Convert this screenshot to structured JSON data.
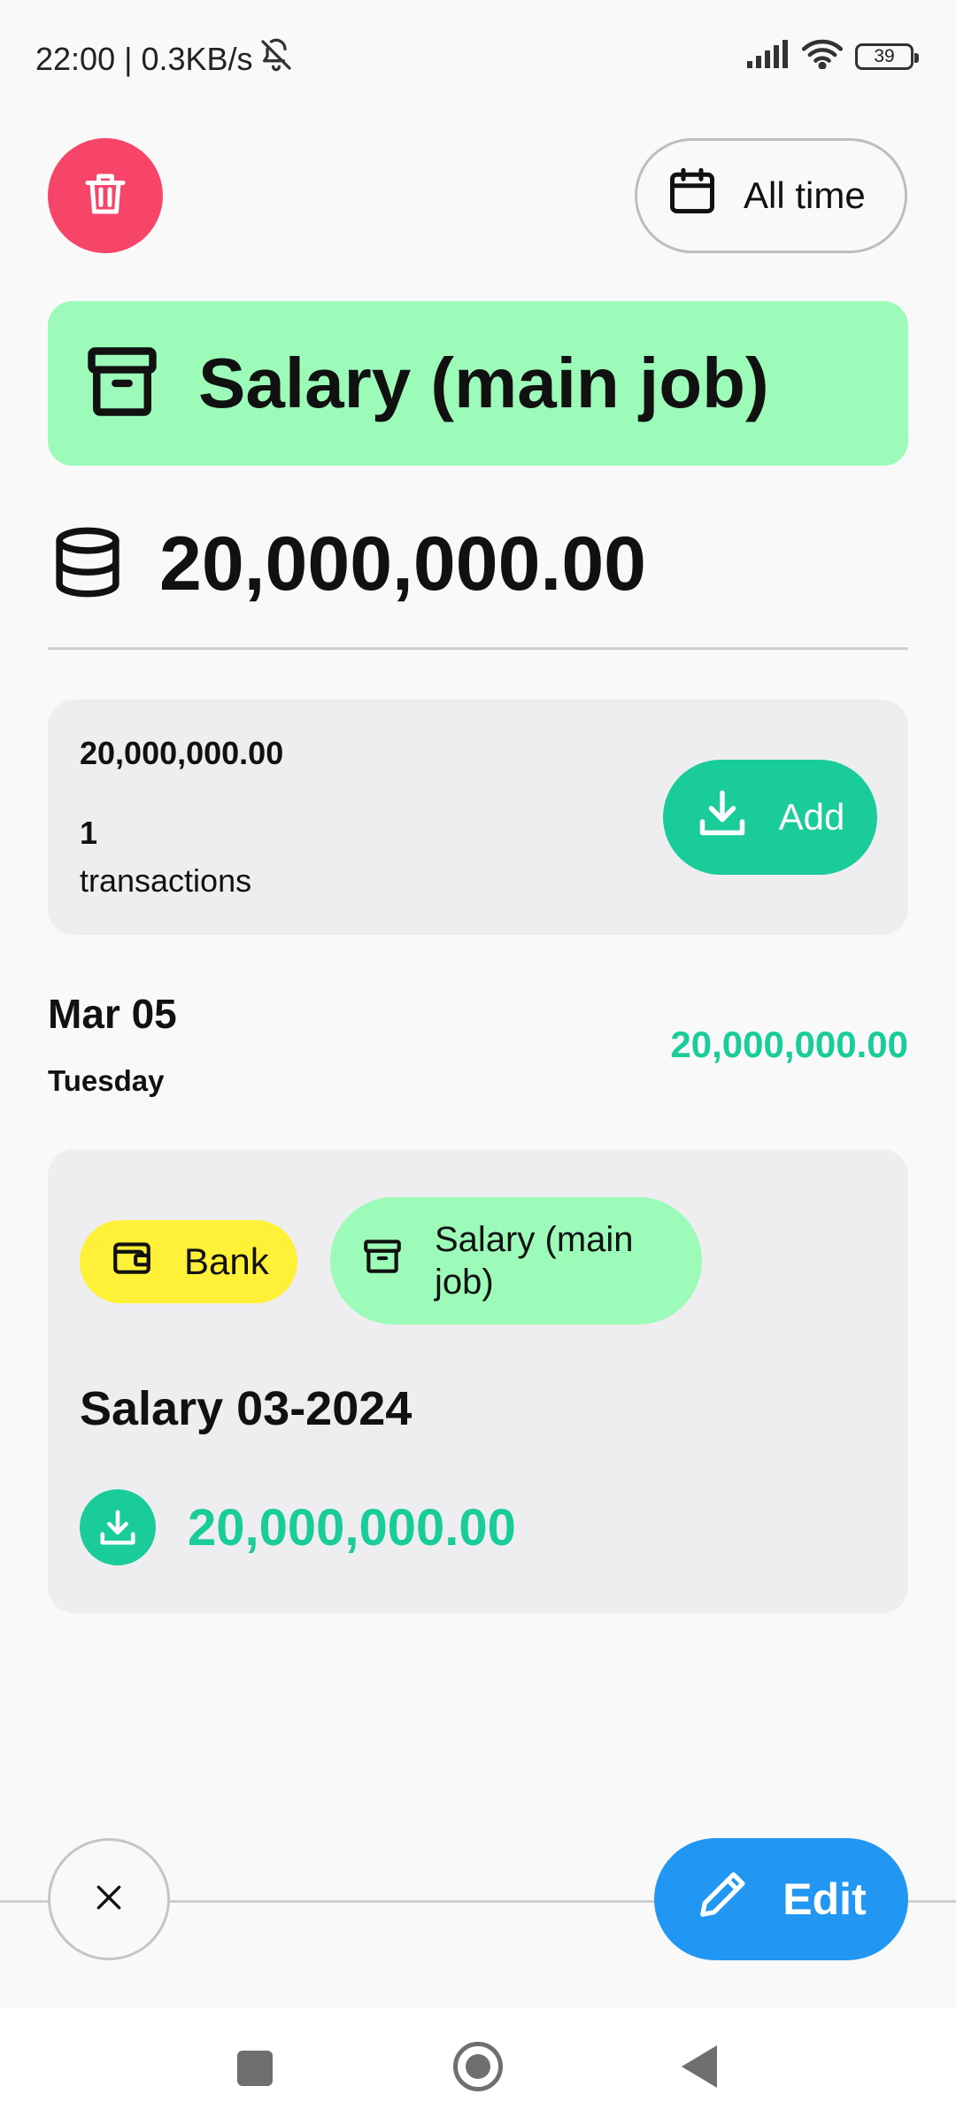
{
  "status_bar": {
    "time_text": "22:00 | 0.3KB/s",
    "battery": "39",
    "icons": [
      "bell-off-icon",
      "signal-icon",
      "wifi-icon",
      "battery-icon"
    ]
  },
  "header": {
    "delete_icon": "trash-icon",
    "period_label": "All time",
    "period_icon": "calendar-icon"
  },
  "category": {
    "title": "Salary (main job)",
    "icon": "archive-box-icon",
    "color": "#9cfbb8"
  },
  "total": {
    "amount": "20,000,000.00",
    "icon": "coins-stack-icon"
  },
  "summary": {
    "amount": "20,000,000.00",
    "count": "1",
    "count_label": "transactions",
    "add_label": "Add",
    "add_color": "#19cc9a"
  },
  "groups": [
    {
      "date": "Mar 05",
      "weekday": "Tuesday",
      "total": "20,000,000.00",
      "transactions": [
        {
          "account": "Bank",
          "account_color": "#fff038",
          "category": "Salary (main job)",
          "category_color": "#9cfbb8",
          "title": "Salary 03-2024",
          "amount": "20,000,000.00"
        }
      ]
    }
  ],
  "actions": {
    "edit_label": "Edit",
    "edit_color": "#2196f3",
    "delete_color": "#f7456a"
  }
}
